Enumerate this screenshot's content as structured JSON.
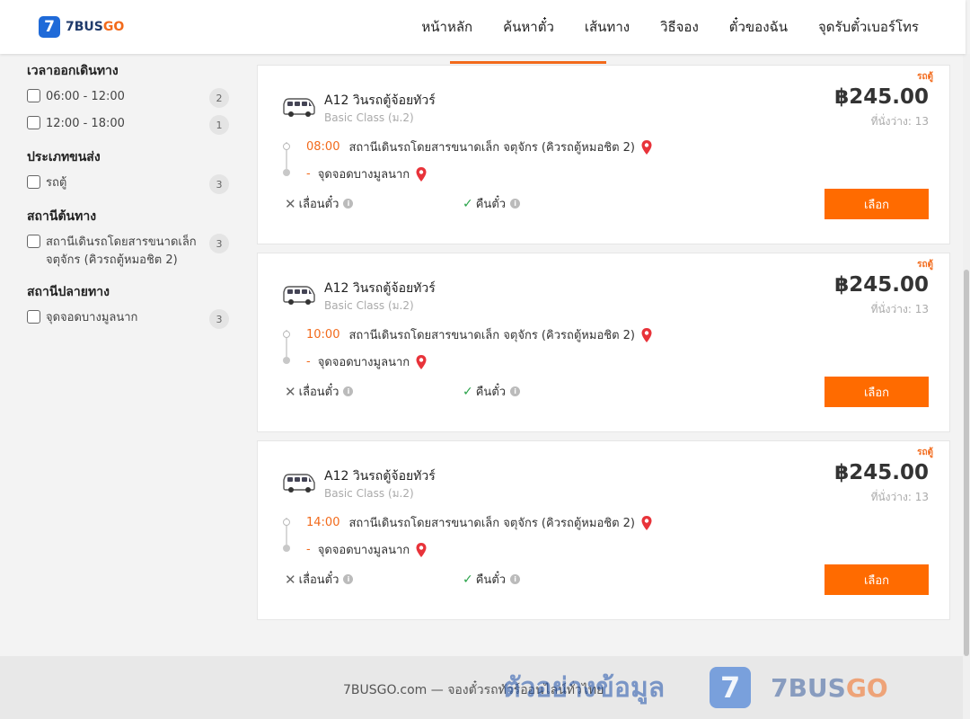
{
  "header": {
    "logo_mark": "7",
    "logo_text_main": "7BUS",
    "logo_text_accent": "GO",
    "nav": [
      "หน้าหลัก",
      "ค้นหาตั๋ว",
      "เส้นทาง",
      "วิธีจอง",
      "ตั๋วของฉัน",
      "จุดรับตั๋วเบอร์โทร"
    ]
  },
  "sidebar": {
    "groups": [
      {
        "title": "เวลาออกเดินทาง",
        "options": [
          {
            "label": "06:00 - 12:00",
            "count": "2"
          },
          {
            "label": "12:00 - 18:00",
            "count": "1"
          }
        ]
      },
      {
        "title": "ประเภทขนส่ง",
        "options": [
          {
            "label": "รถตู้",
            "count": "3"
          }
        ]
      },
      {
        "title": "สถานีต้นทาง",
        "options": [
          {
            "label": "สถานีเดินรถโดยสารขนาดเล็ก จตุจักร (คิวรถตู้หมอชิต 2)",
            "count": "3"
          }
        ]
      },
      {
        "title": "สถานีปลายทาง",
        "options": [
          {
            "label": "จุดจอดบางมูลนาก",
            "count": "3"
          }
        ]
      }
    ]
  },
  "results": [
    {
      "type_tag": "รถตู้",
      "route_name": "A12 วินรถตู้จ้อยทัวร์",
      "class": "Basic Class (ม.2)",
      "price": "฿245.00",
      "seats": "ที่นั่งว่าง: 13",
      "dep_time": "08:00",
      "dep_station": "สถานีเดินรถโดยสารขนาดเล็ก จตุจักร (คิวรถตู้หมอชิต 2)",
      "arr_dash": "-",
      "arr_station": "จุดจอดบางมูลนาก",
      "cancel_label": "เลื่อนตั๋ว",
      "refund_label": "คืนตั๋ว",
      "select_label": "เลือก"
    },
    {
      "type_tag": "รถตู้",
      "route_name": "A12 วินรถตู้จ้อยทัวร์",
      "class": "Basic Class (ม.2)",
      "price": "฿245.00",
      "seats": "ที่นั่งว่าง: 13",
      "dep_time": "10:00",
      "dep_station": "สถานีเดินรถโดยสารขนาดเล็ก จตุจักร (คิวรถตู้หมอชิต 2)",
      "arr_dash": "-",
      "arr_station": "จุดจอดบางมูลนาก",
      "cancel_label": "เลื่อนตั๋ว",
      "refund_label": "คืนตั๋ว",
      "select_label": "เลือก"
    },
    {
      "type_tag": "รถตู้",
      "route_name": "A12 วินรถตู้จ้อยทัวร์",
      "class": "Basic Class (ม.2)",
      "price": "฿245.00",
      "seats": "ที่นั่งว่าง: 13",
      "dep_time": "14:00",
      "dep_station": "สถานีเดินรถโดยสารขนาดเล็ก จตุจักร (คิวรถตู้หมอชิต 2)",
      "arr_dash": "-",
      "arr_station": "จุดจอดบางมูลนาก",
      "cancel_label": "เลื่อนตั๋ว",
      "refund_label": "คืนตั๋ว",
      "select_label": "เลือก"
    }
  ],
  "footer": {
    "text": "7BUSGO.com — จองตั๋วรถทัวร์ออนไลน์ทั่วไทย",
    "watermark_text": "ตัวอย่างข้อมูล",
    "watermark_logo_mark": "7",
    "watermark_brand_main": "7BUS",
    "watermark_brand_accent": "GO"
  },
  "colors": {
    "accent": "#ff6b00",
    "brand_blue": "#1f6ad8",
    "check_green": "#2aa34a",
    "pin_red": "#e8333a"
  },
  "icons": {
    "van": "van-icon",
    "pin": "map-pin-icon",
    "cancel": "x-icon",
    "refund": "check-icon",
    "info": "info-icon"
  }
}
